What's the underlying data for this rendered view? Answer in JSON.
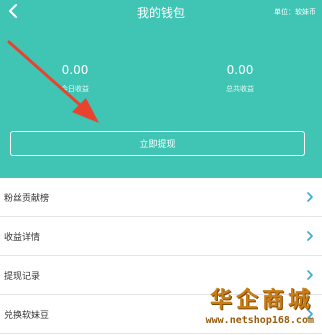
{
  "header": {
    "title": "我的钱包",
    "unit": "单位：软妹币",
    "bg_color": "#40c4b4",
    "back_icon": "chevron-left-icon"
  },
  "stats": {
    "today_value": "0.00",
    "today_label": "今日收益",
    "total_value": "0.00",
    "total_label": "总共收益"
  },
  "withdraw": {
    "label": "立即提现"
  },
  "menu": {
    "items": [
      {
        "label": "粉丝贡献榜",
        "icon": "chevron-right-icon"
      },
      {
        "label": "收益详情",
        "icon": "chevron-right-icon"
      },
      {
        "label": "提现记录",
        "icon": "chevron-right-icon"
      },
      {
        "label": "兑换软妹豆",
        "icon": "chevron-right-icon"
      }
    ]
  },
  "watermark": {
    "text": "华企商城",
    "url": "www.netshop168.com"
  },
  "annotation_arrow": {
    "color": "#e8432e"
  }
}
